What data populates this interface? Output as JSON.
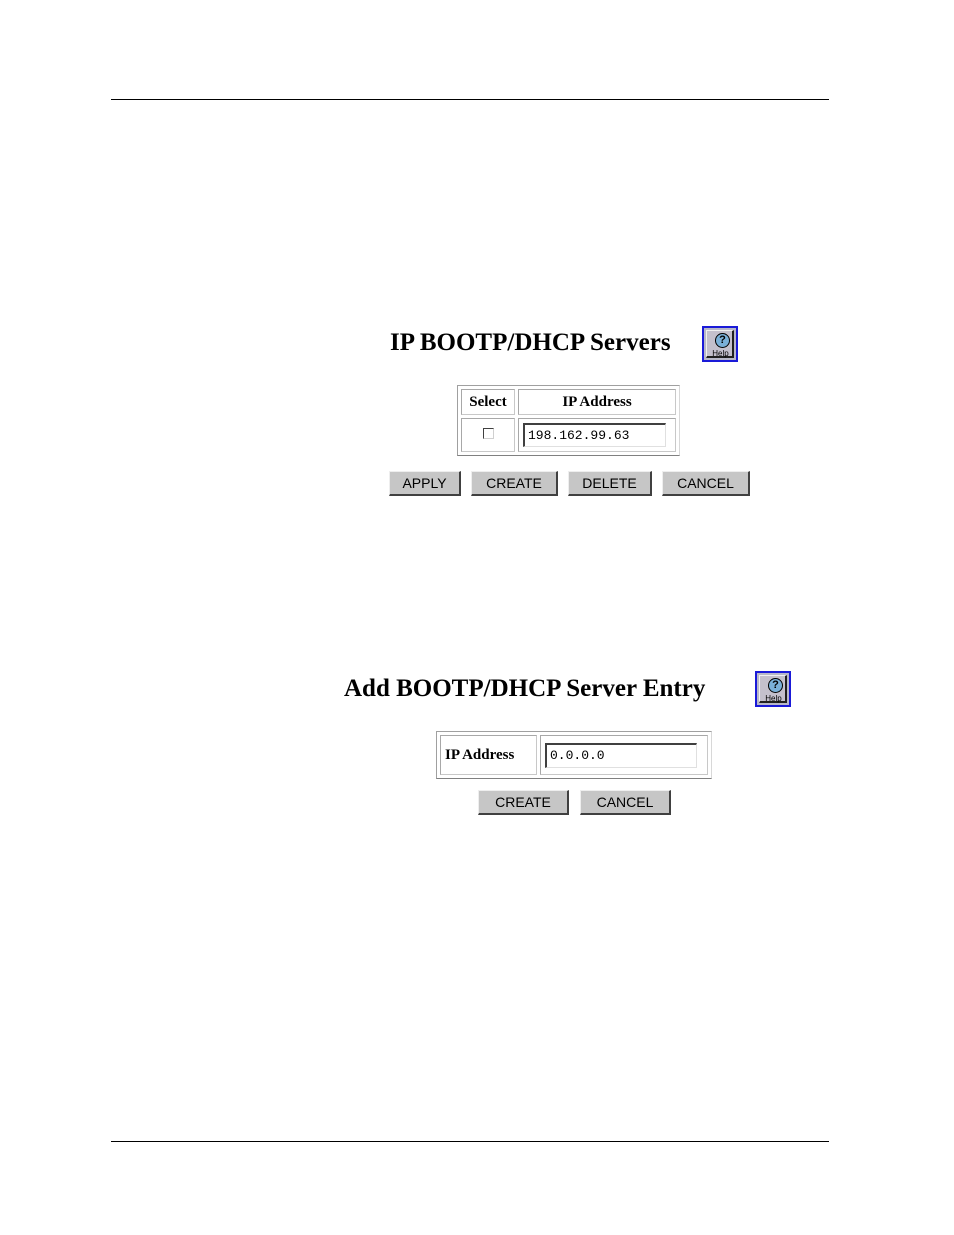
{
  "servers_panel": {
    "title": "IP BOOTP/DHCP Servers",
    "help": {
      "icon": "help-icon",
      "glyph": "?",
      "label": "Help"
    },
    "table": {
      "columns": [
        "Select",
        "IP Address"
      ],
      "rows": [
        {
          "selected": false,
          "ip_address": "198.162.99.63"
        }
      ]
    },
    "buttons": {
      "apply": "APPLY",
      "create": "CREATE",
      "delete": "DELETE",
      "cancel": "CANCEL"
    }
  },
  "add_panel": {
    "title": "Add BOOTP/DHCP Server Entry",
    "help": {
      "icon": "help-icon",
      "glyph": "?",
      "label": "Help"
    },
    "field_label": "IP Address",
    "field_value": "0.0.0.0",
    "buttons": {
      "create": "CREATE",
      "cancel": "CANCEL"
    }
  }
}
